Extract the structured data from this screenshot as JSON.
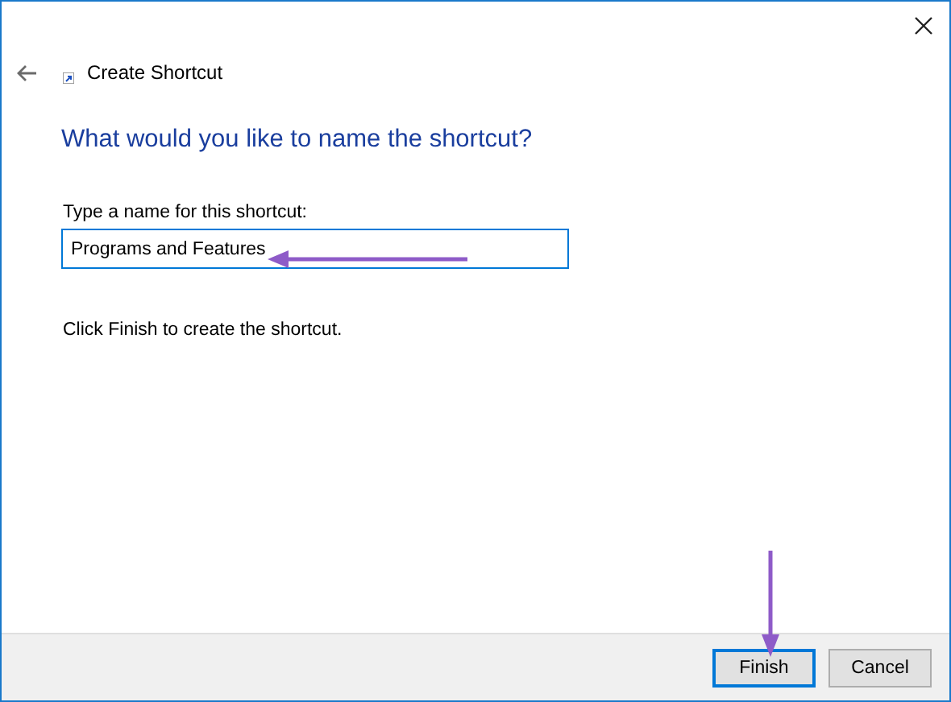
{
  "window": {
    "title": "Create Shortcut"
  },
  "heading": "What would you like to name the shortcut?",
  "name_field": {
    "label": "Type a name for this shortcut:",
    "value": "Programs and Features",
    "focused": true
  },
  "instruction": "Click Finish to create the shortcut.",
  "buttons": [
    {
      "label": "Finish",
      "default": true
    },
    {
      "label": "Cancel",
      "default": false
    }
  ]
}
